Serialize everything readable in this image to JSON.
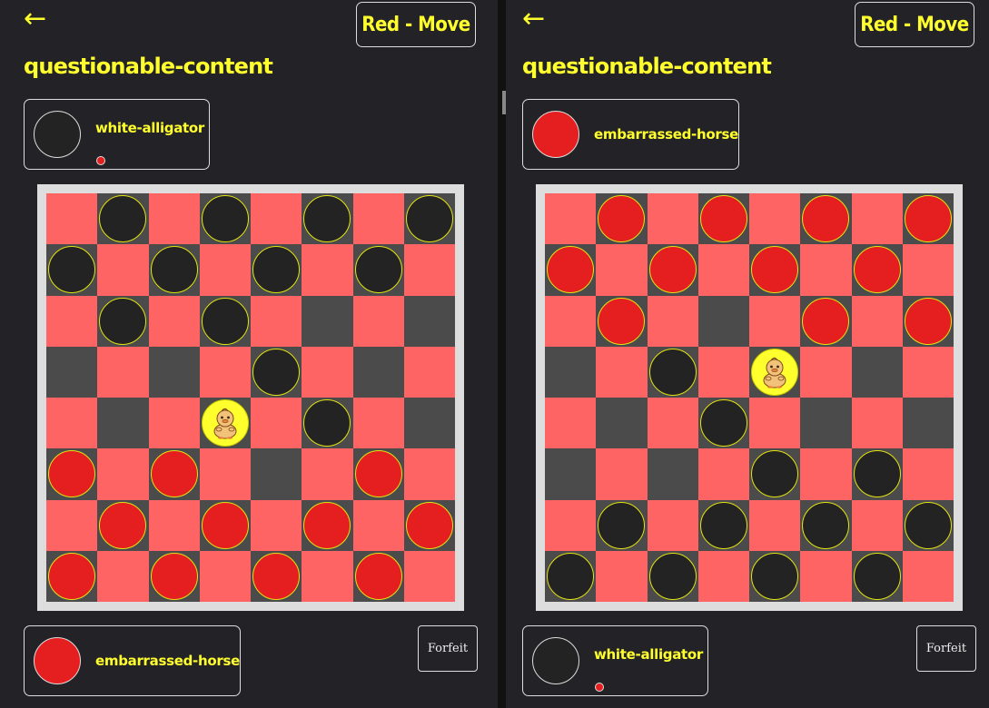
{
  "panels": [
    {
      "back_label": "←",
      "status_label": "Red - Move",
      "game_title": "questionable-content",
      "top_player": {
        "name": "white-alligator",
        "color": "black",
        "turn_indicator": true
      },
      "bottom_player": {
        "name": "embarrassed-horse",
        "color": "red",
        "turn_indicator": false
      },
      "forfeit_label": "Forfeit",
      "board": [
        ". b . b . b . b",
        "b . b . b . b .",
        ". b . b . . . .",
        ". . . . b . . .",
        ". . . D . b . .",
        "r . r . . . r .",
        ". r . r . r . r",
        "r . r . r . r ."
      ]
    },
    {
      "back_label": "←",
      "status_label": "Red - Move",
      "game_title": "questionable-content",
      "top_player": {
        "name": "embarrassed-horse",
        "color": "red",
        "turn_indicator": false
      },
      "bottom_player": {
        "name": "white-alligator",
        "color": "black",
        "turn_indicator": true
      },
      "forfeit_label": "Forfeit",
      "board": [
        ". r . r . r . r",
        "r . r . r . r .",
        ". r . . . r . r",
        ". . b . D . . .",
        ". . . b . . . .",
        ". . . . b . b .",
        ". b . b . b . b",
        "b . b . b . b ."
      ]
    }
  ],
  "colors": {
    "accent": "#ffff2e",
    "light_square": "#ff6464",
    "dark_square": "#4b4b4b",
    "red_piece": "#e51f1f",
    "black_piece": "#232323",
    "background": "#232226"
  },
  "icons": {
    "back": "arrow-left-icon",
    "duck": "duck-icon"
  }
}
